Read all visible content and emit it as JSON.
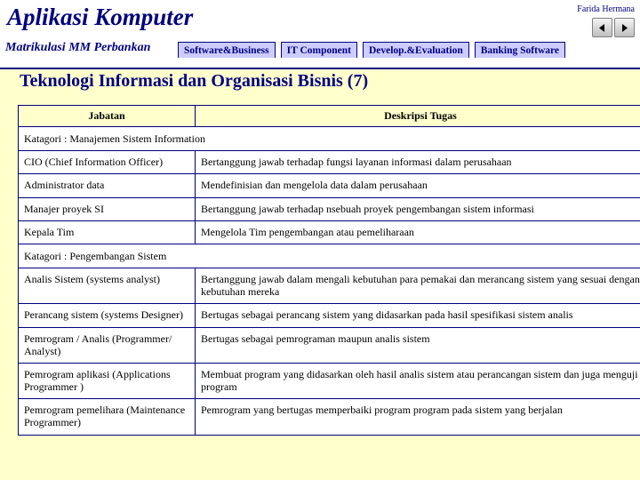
{
  "header": {
    "title": "Aplikasi Komputer",
    "subtitle": "Matrikulasi MM Perbankan",
    "author": "Farida Hermana",
    "prev_icon": "left-triangle-icon",
    "next_icon": "right-triangle-icon"
  },
  "tabs": [
    {
      "label": "Software&Business"
    },
    {
      "label": "IT Component"
    },
    {
      "label": "Develop.&Evaluation"
    },
    {
      "label": "Banking Software"
    }
  ],
  "slide": {
    "title": "Teknologi Informasi dan Organisasi Bisnis (7)",
    "table": {
      "headers": [
        "Jabatan",
        "Deskripsi Tugas"
      ],
      "rows": [
        {
          "type": "category",
          "text": "Katagori : Manajemen Sistem Information"
        },
        {
          "type": "data",
          "jabatan": "CIO (Chief Information Officer)",
          "deskripsi": "Bertanggung jawab terhadap fungsi layanan informasi dalam perusahaan"
        },
        {
          "type": "data",
          "jabatan": "Administrator data",
          "deskripsi": "Mendefinisian dan mengelola data dalam perusahaan"
        },
        {
          "type": "data",
          "jabatan": "Manajer proyek SI",
          "deskripsi": "Bertanggung jawab terhadap nsebuah proyek pengembangan sistem informasi"
        },
        {
          "type": "data",
          "jabatan": "Kepala Tim",
          "deskripsi": "Mengelola Tim pengembangan atau pemeliharaan"
        },
        {
          "type": "category",
          "text": "Katagori : Pengembangan Sistem"
        },
        {
          "type": "data",
          "jabatan": "Analis Sistem (systems analyst)",
          "deskripsi": "Bertanggung jawab dalam mengali kebutuhan para pemakai dan merancang sistem yang sesuai dengan kebutuhan mereka"
        },
        {
          "type": "data",
          "jabatan": "Perancang sistem (systems Designer)",
          "deskripsi": "Bertugas sebagai perancang sistem yang didasarkan pada hasil spesifikasi sistem analis"
        },
        {
          "type": "data",
          "jabatan": "Pemrogram / Analis (Programmer/ Analyst)",
          "deskripsi": "Bertugas sebagai pemrograman maupun analis sistem"
        },
        {
          "type": "data",
          "jabatan": "Pemrogram aplikasi (Applications Programmer )",
          "deskripsi": "Membuat program yang didasarkan oleh hasil analis sistem atau perancangan sistem dan juga menguji program"
        },
        {
          "type": "data",
          "jabatan": "Pemrogram pemelihara (Maintenance Programmer)",
          "deskripsi": "Pemrogram yang bertugas memperbaiki program program pada sistem yang berjalan"
        }
      ]
    }
  },
  "colors": {
    "accent": "#000080",
    "background": "#ffffcc",
    "tab_fill": "#ccccff",
    "header_fill": "#ffffcc"
  }
}
